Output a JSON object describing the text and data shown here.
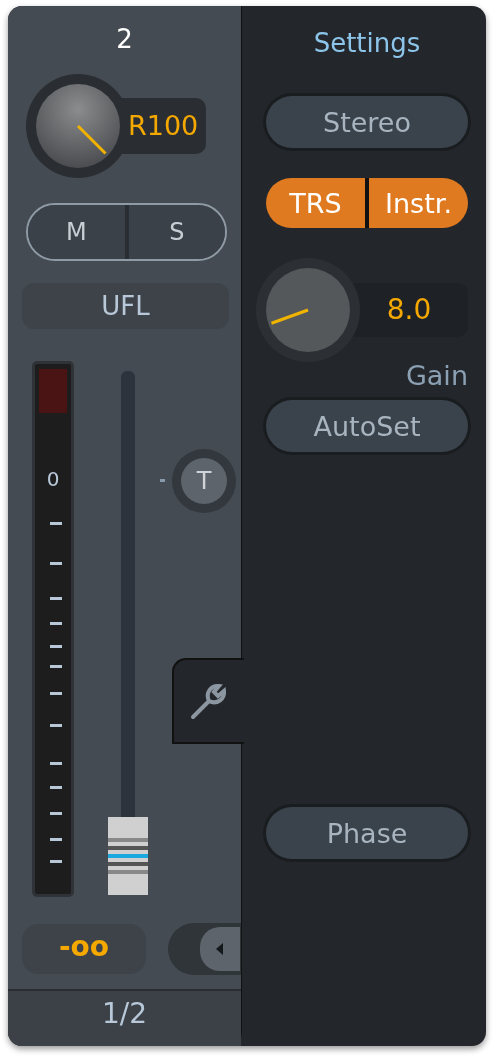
{
  "channel": {
    "number": "2",
    "pan": {
      "reading": "R100"
    },
    "mute": {
      "label": "M",
      "on": false
    },
    "solo": {
      "label": "S",
      "on": false
    },
    "name": "UFL",
    "meter": {
      "scale_label": "0"
    },
    "talkback": {
      "label": "T",
      "on": false
    },
    "fader": {
      "reading": "-oo"
    },
    "output": "1/2"
  },
  "settings": {
    "title": "Settings",
    "mode": {
      "label": "Stereo",
      "on": false
    },
    "input_options": [
      {
        "label": "TRS",
        "on": true
      },
      {
        "label": "Instr.",
        "on": true
      }
    ],
    "gain": {
      "reading": "8.0",
      "label": "Gain"
    },
    "autoset": {
      "label": "AutoSet",
      "on": false
    },
    "phase": {
      "label": "Phase",
      "on": false
    }
  }
}
